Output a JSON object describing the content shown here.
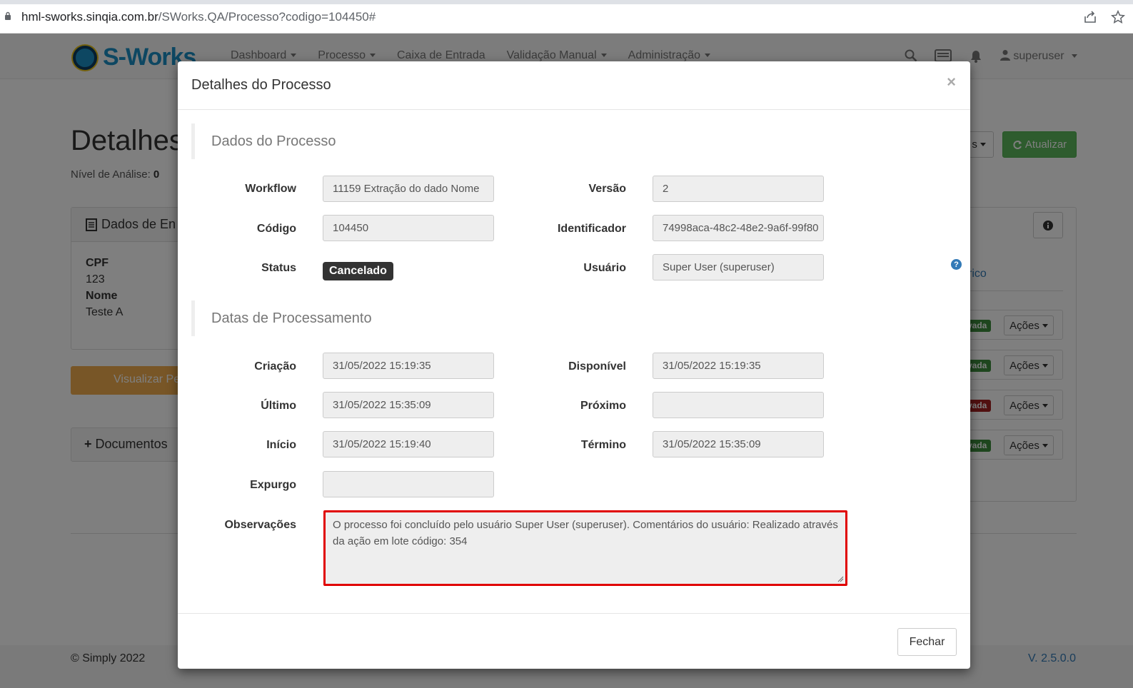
{
  "browser": {
    "url_host": "hml-sworks.sinqia.com.br",
    "url_path": "/SWorks.QA/Processo?codigo=104450#"
  },
  "app": {
    "logo_text": "S-Works",
    "nav": [
      "Dashboard",
      "Processo",
      "Caixa de Entrada",
      "Validação Manual",
      "Administração"
    ],
    "user": "superuser",
    "page_title": "Detalhes",
    "level_label": "Nível de Análise:",
    "level_value": "0",
    "atualizar_label": "Atualizar",
    "other_btn_label": "s",
    "panel_left_title": "Dados de En",
    "fields": [
      {
        "label": "CPF",
        "value": "123"
      },
      {
        "label": "Nome",
        "value": "Teste A"
      }
    ],
    "visualizar_label": "Visualizar Pe",
    "documentos_label": "Documentos",
    "right_link": "rico",
    "rows": [
      {
        "badge": "vada",
        "color": "#3c8c3c",
        "acoes": "Ações"
      },
      {
        "badge": "vada",
        "color": "#3c8c3c",
        "acoes": "Ações"
      },
      {
        "badge": "vada",
        "color": "#a32020",
        "acoes": "Ações"
      },
      {
        "badge": "vada",
        "color": "#3c8c3c",
        "acoes": "Ações"
      }
    ],
    "footer_copy": "© Simply 2022",
    "footer_version": "V. 2.5.0.0"
  },
  "modal": {
    "title": "Detalhes do Processo",
    "close": "×",
    "section1": "Dados do Processo",
    "section2": "Datas de Processamento",
    "workflow": {
      "label": "Workflow",
      "value": "11159 Extração do dado Nome"
    },
    "versao": {
      "label": "Versão",
      "value": "2"
    },
    "codigo": {
      "label": "Código",
      "value": "104450"
    },
    "identificador": {
      "label": "Identificador",
      "value": "74998aca-48c2-48e2-9a6f-99f80"
    },
    "status": {
      "label": "Status",
      "value": "Cancelado"
    },
    "usuario": {
      "label": "Usuário",
      "value": "Super User (superuser)"
    },
    "criacao": {
      "label": "Criação",
      "value": "31/05/2022 15:19:35"
    },
    "disponivel": {
      "label": "Disponível",
      "value": "31/05/2022 15:19:35"
    },
    "ultimo": {
      "label": "Último",
      "value": "31/05/2022 15:35:09"
    },
    "proximo": {
      "label": "Próximo",
      "value": ""
    },
    "inicio": {
      "label": "Início",
      "value": "31/05/2022 15:19:40"
    },
    "termino": {
      "label": "Término",
      "value": "31/05/2022 15:35:09"
    },
    "expurgo": {
      "label": "Expurgo",
      "value": ""
    },
    "observacoes": {
      "label": "Observações",
      "value": "O processo foi concluído pelo usuário Super User (superuser). Comentários do usuário: Realizado através da ação em lote código: 354"
    },
    "fechar_label": "Fechar"
  }
}
